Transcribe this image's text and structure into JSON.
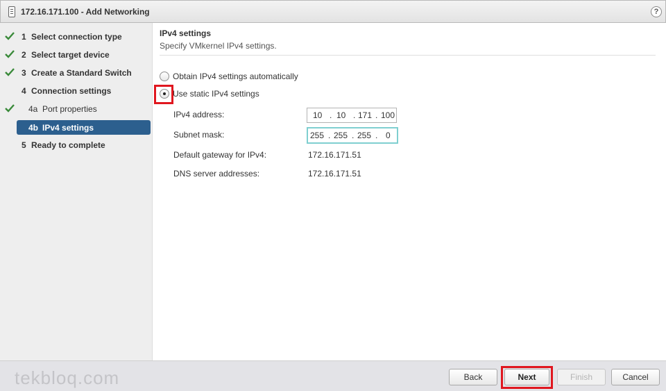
{
  "window": {
    "title": "172.16.171.100 - Add Networking",
    "help_label": "?"
  },
  "steps": [
    {
      "num": "1",
      "label": "Select connection type",
      "done": true
    },
    {
      "num": "2",
      "label": "Select target device",
      "done": true
    },
    {
      "num": "3",
      "label": "Create a Standard Switch",
      "done": true
    },
    {
      "num": "4",
      "label": "Connection settings",
      "done": false
    },
    {
      "num": "4a",
      "label": "Port properties",
      "done": true
    },
    {
      "num": "4b",
      "label": "IPv4 settings",
      "done": false,
      "active": true
    },
    {
      "num": "5",
      "label": "Ready to complete",
      "done": false
    }
  ],
  "main": {
    "section_title": "IPv4 settings",
    "section_subtitle": "Specify VMkernel IPv4 settings.",
    "radio_auto": "Obtain IPv4 settings automatically",
    "radio_static": "Use static IPv4 settings",
    "selected_radio": "static",
    "ipv4_label": "IPv4 address:",
    "ipv4_octets": [
      "10",
      ".",
      "10",
      ".",
      "171",
      ".",
      "100"
    ],
    "subnet_label": "Subnet mask:",
    "subnet_octets": [
      "255",
      ".",
      "255",
      ".",
      "255",
      ".",
      "0"
    ],
    "gateway_label": "Default gateway for IPv4:",
    "gateway_value": "172.16.171.51",
    "dns_label": "DNS server addresses:",
    "dns_value": "172.16.171.51"
  },
  "footer": {
    "watermark": "tekbloq.com",
    "back": "Back",
    "next": "Next",
    "finish": "Finish",
    "cancel": "Cancel"
  },
  "colors": {
    "active_step": "#2c5f8e",
    "check": "#3a8a3a",
    "highlight": "#e0171f",
    "focus_border": "#7fcfd0"
  }
}
